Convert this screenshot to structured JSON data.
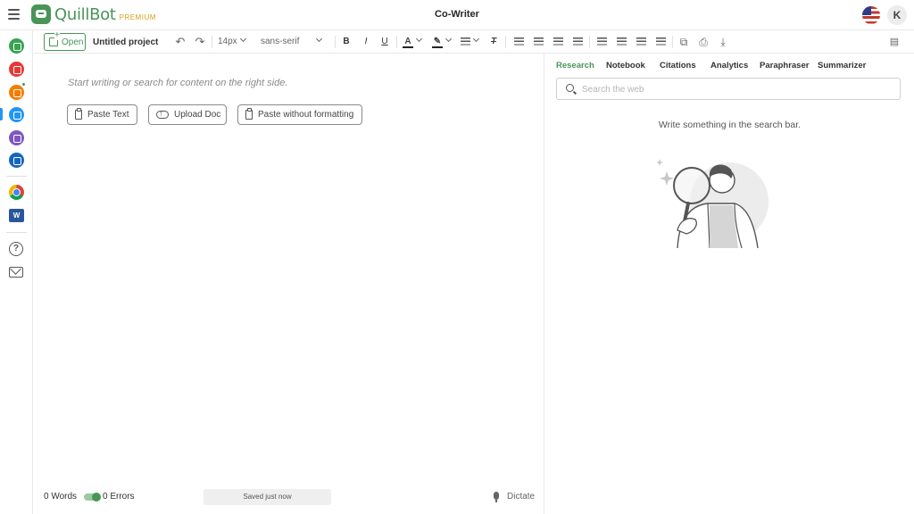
{
  "header": {
    "brand": "QuillBot",
    "tier": "PREMIUM",
    "title": "Co-Writer",
    "avatar_initial": "K"
  },
  "sidebar": {
    "items": [
      {
        "name": "summarizer",
        "color": "#3aa352"
      },
      {
        "name": "grammar-checker",
        "color": "#e53935"
      },
      {
        "name": "citation",
        "color": "#f57c00"
      },
      {
        "name": "co-writer",
        "color": "#2196f3"
      },
      {
        "name": "paraphraser",
        "color": "#7e57c2"
      },
      {
        "name": "quote",
        "color": "#1565c0"
      }
    ],
    "word_label": "W",
    "help_label": "?"
  },
  "toolbar": {
    "open_label": "Open",
    "project_name": "Untitled project",
    "font_size": "14px",
    "font_family": "sans-serif",
    "bold": "B",
    "italic": "I",
    "underline": "U",
    "text_color": "A",
    "clear_format": "T"
  },
  "editor": {
    "placeholder": "Start writing or search for content on the right side.",
    "paste_text": "Paste Text",
    "upload_doc": "Upload Doc",
    "paste_no_format": "Paste without formatting",
    "words": "0 Words",
    "errors": "0 Errors",
    "saved": "Saved just now",
    "dictate": "Dictate"
  },
  "panel": {
    "tabs": [
      "Research",
      "Notebook",
      "Citations",
      "Analytics",
      "Paraphraser",
      "Summarizer"
    ],
    "active_tab": "Research",
    "search_placeholder": "Search the web",
    "empty_message": "Write something in the search bar."
  },
  "colors": {
    "brand": "#499557",
    "premium": "#d2a21b"
  }
}
